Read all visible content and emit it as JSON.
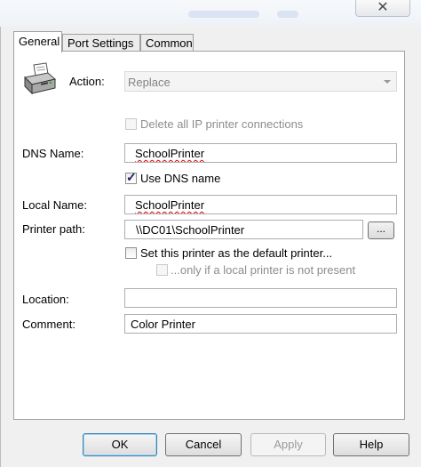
{
  "window": {
    "close_glyph": "✕"
  },
  "tabs": [
    {
      "label": "General",
      "active": true
    },
    {
      "label": "Port Settings",
      "active": false
    },
    {
      "label": "Common",
      "active": false
    }
  ],
  "icon": {
    "name": "printer-icon"
  },
  "action": {
    "label": "Action:",
    "value": "Replace",
    "enabled": false
  },
  "delete_ip": {
    "label": "Delete all IP printer connections",
    "checked": false,
    "enabled": false
  },
  "dns_name": {
    "label": "DNS Name:",
    "value": "SchoolPrinter"
  },
  "use_dns": {
    "label": "Use DNS name",
    "checked": true
  },
  "local_name": {
    "label": "Local Name:",
    "value": "SchoolPrinter"
  },
  "printer_path": {
    "label": "Printer path:",
    "value": "\\\\DC01\\SchoolPrinter",
    "browse_label": "..."
  },
  "default_printer": {
    "label": "Set this printer as the default printer...",
    "checked": false
  },
  "only_if_local": {
    "label": "...only if a local printer is not present",
    "checked": false,
    "enabled": false
  },
  "location": {
    "label": "Location:",
    "value": ""
  },
  "comment": {
    "label": "Comment:",
    "value": "Color Printer"
  },
  "buttons": {
    "ok": "OK",
    "cancel": "Cancel",
    "apply": "Apply",
    "help": "Help"
  }
}
